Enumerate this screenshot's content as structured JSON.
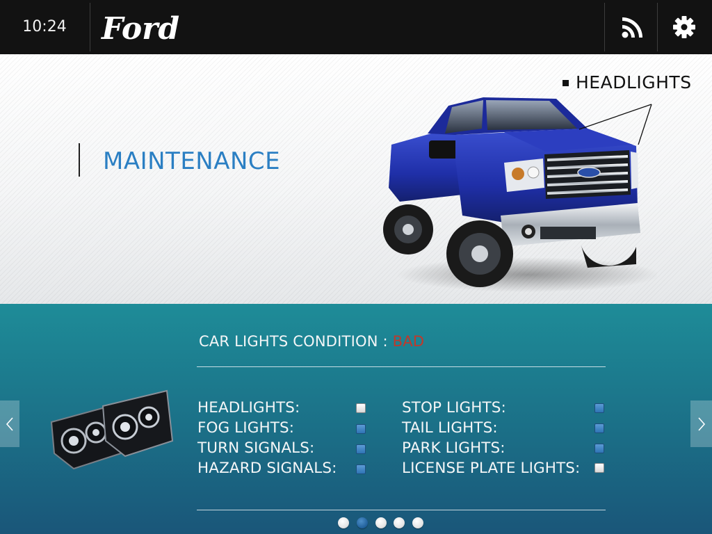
{
  "statusbar": {
    "time": "10:24",
    "brand": "Ford",
    "icons": [
      "rss-icon",
      "gear-icon"
    ]
  },
  "hero": {
    "title": "MAINTENANCE",
    "callout_label": "HEADLIGHTS"
  },
  "panel": {
    "condition_label": "CAR LIGHTS CONDITION : ",
    "condition_value": "BAD",
    "left_column": [
      {
        "label": "HEADLIGHTS:",
        "checked": false
      },
      {
        "label": "FOG LIGHTS:",
        "checked": true
      },
      {
        "label": "TURN SIGNALS:",
        "checked": true
      },
      {
        "label": "HAZARD SIGNALS:",
        "checked": true
      }
    ],
    "right_column": [
      {
        "label": "STOP LIGHTS:",
        "checked": true
      },
      {
        "label": "TAIL LIGHTS:",
        "checked": true
      },
      {
        "label": "PARK LIGHTS:",
        "checked": true
      },
      {
        "label": "LICENSE PLATE LIGHTS:",
        "checked": false
      }
    ],
    "pagination": {
      "total": 5,
      "active": 2
    }
  },
  "colors": {
    "accent_blue": "#2b7fc3",
    "bad_red": "#c0392b",
    "panel_teal": "#1e8c98",
    "topbar": "#121212"
  }
}
